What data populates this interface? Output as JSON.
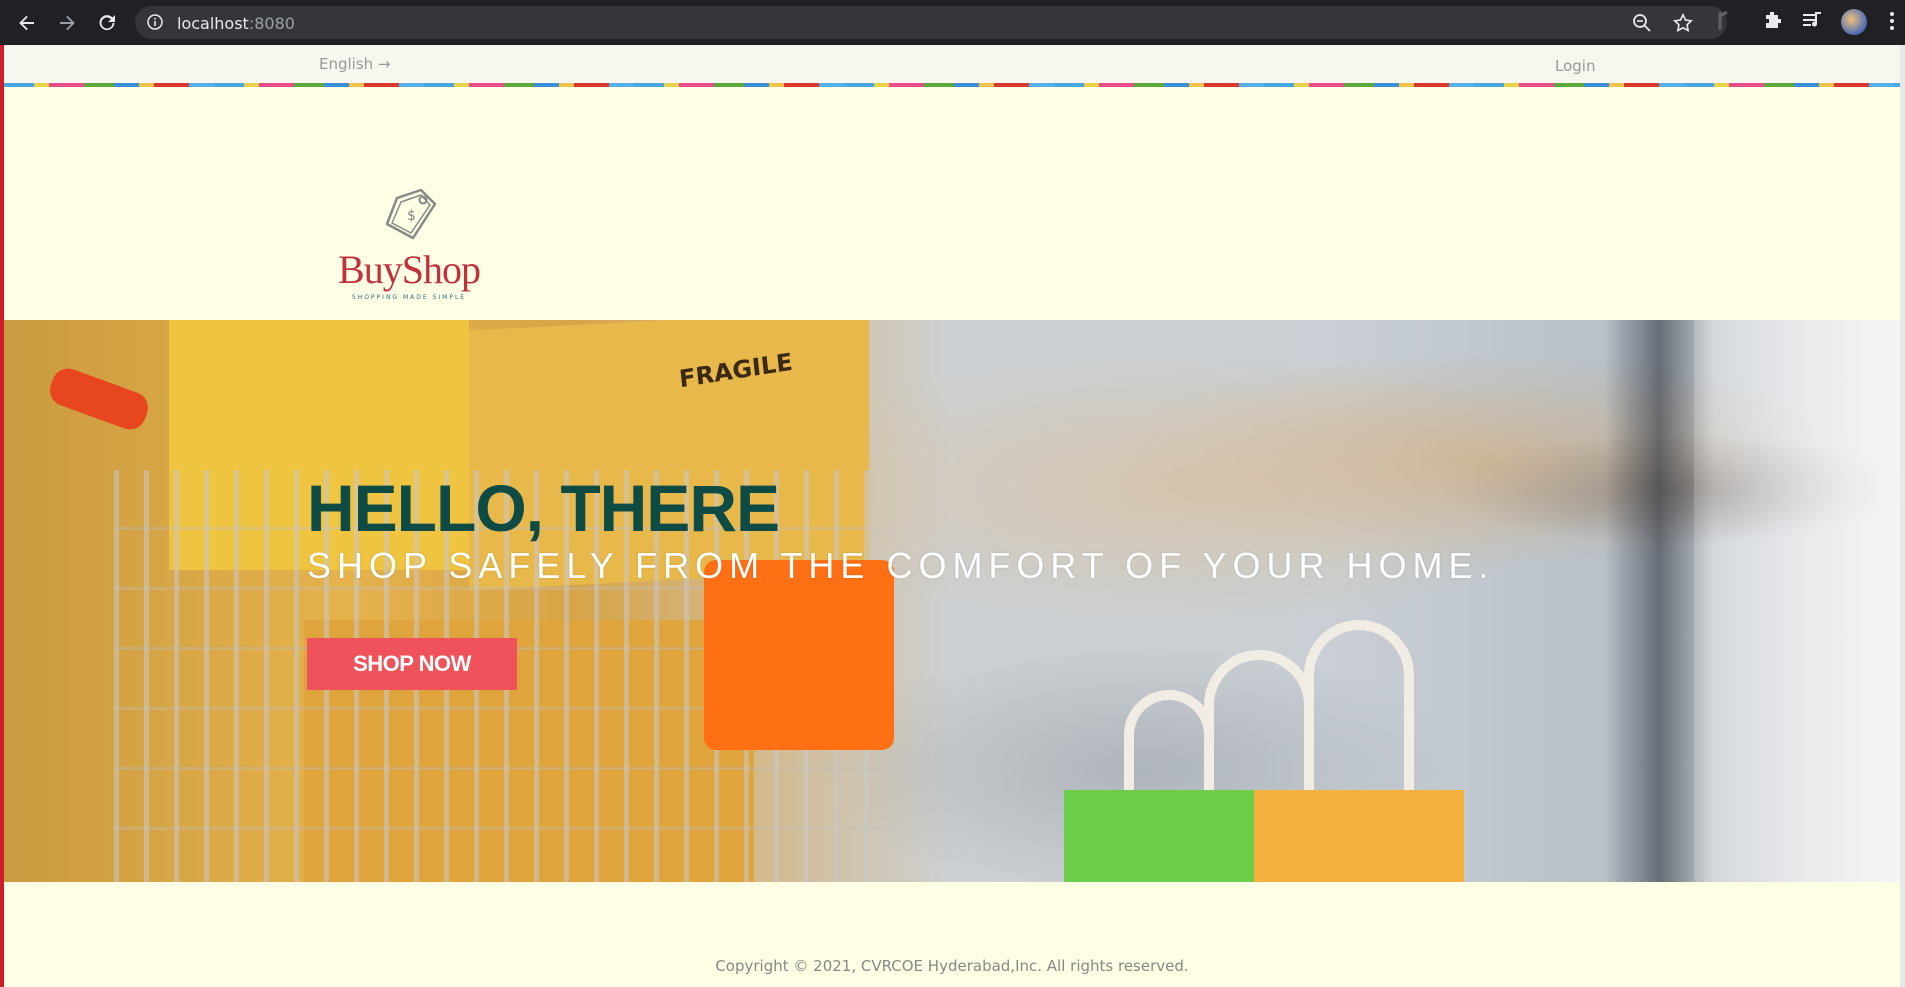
{
  "browser": {
    "url_host": "localhost",
    "url_port": ":8080",
    "icons": [
      "back-icon",
      "forward-icon",
      "reload-icon",
      "info-icon",
      "zoom-icon",
      "star-icon",
      "extensions-icon",
      "media-icon",
      "profile-avatar",
      "menu-icon"
    ]
  },
  "topbar": {
    "language": "English →",
    "login": "Login"
  },
  "logo": {
    "brand": "BuyShop",
    "tagline": "SHOPPING MADE SIMPLE"
  },
  "hero": {
    "title": "HELLO, THERE",
    "subtitle": "SHOP SAFELY FROM THE COMFORT OF YOUR HOME.",
    "cta": "SHOP NOW",
    "image_text": "FRAGILE"
  },
  "footer": {
    "copyright": "Copyright © 2021, CVRCOE Hyderabad,Inc. All rights reserved."
  },
  "colors": {
    "chrome": "#202124",
    "page_bg": "#fefee4",
    "title": "#0e4b45",
    "cta_bg": "#f0525b",
    "brand": "#c0313d"
  }
}
